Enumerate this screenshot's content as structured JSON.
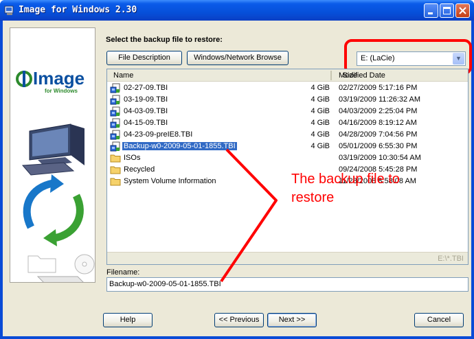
{
  "window": {
    "title": "Image for Windows 2.30"
  },
  "sidebar": {
    "logo_text": "Image",
    "logo_subtitle": "for Windows"
  },
  "instructions": "Select the backup file to restore:",
  "toolbar": {
    "file_description_label": "File Description",
    "network_browse_label": "Windows/Network Browse"
  },
  "drive_select": {
    "value": "E: (LaCie)"
  },
  "file_list": {
    "columns": {
      "name": "Name",
      "size": "Size",
      "modified": "Modified Date"
    },
    "rows": [
      {
        "name": "02-27-09.TBI",
        "size": "4 GiB",
        "modified": "02/27/2009 5:17:16 PM",
        "type": "file"
      },
      {
        "name": "03-19-09.TBI",
        "size": "4 GiB",
        "modified": "03/19/2009 11:26:32 AM",
        "type": "file"
      },
      {
        "name": "04-03-09.TBI",
        "size": "4 GiB",
        "modified": "04/03/2009 2:25:04 PM",
        "type": "file"
      },
      {
        "name": "04-15-09.TBI",
        "size": "4 GiB",
        "modified": "04/16/2009 8:19:12 AM",
        "type": "file"
      },
      {
        "name": "04-23-09-preIE8.TBI",
        "size": "4 GiB",
        "modified": "04/28/2009 7:04:56 PM",
        "type": "file"
      },
      {
        "name": "Backup-w0-2009-05-01-1855.TBI",
        "size": "4 GiB",
        "modified": "05/01/2009 6:55:30 PM",
        "type": "file",
        "selected": true
      },
      {
        "name": "ISOs",
        "size": "",
        "modified": "03/19/2009 10:30:54 AM",
        "type": "folder"
      },
      {
        "name": "Recycled",
        "size": "",
        "modified": "09/24/2008 5:45:28 PM",
        "type": "folder"
      },
      {
        "name": "System Volume Information",
        "size": "",
        "modified": "11/28/2008 8:58:08 AM",
        "type": "folder"
      }
    ],
    "status_filter": "E:\\*.TBI"
  },
  "filename": {
    "label": "Filename:",
    "value": "Backup-w0-2009-05-01-1855.TBI"
  },
  "annotation": {
    "line1": "The backup file to",
    "line2": "restore"
  },
  "footer": {
    "help_label": "Help",
    "previous_label": "<< Previous",
    "next_label": "Next >>",
    "cancel_label": "Cancel"
  },
  "colors": {
    "annotation": "#ff0000",
    "selection": "#316ac5",
    "titlebar": "#0a5be9"
  }
}
